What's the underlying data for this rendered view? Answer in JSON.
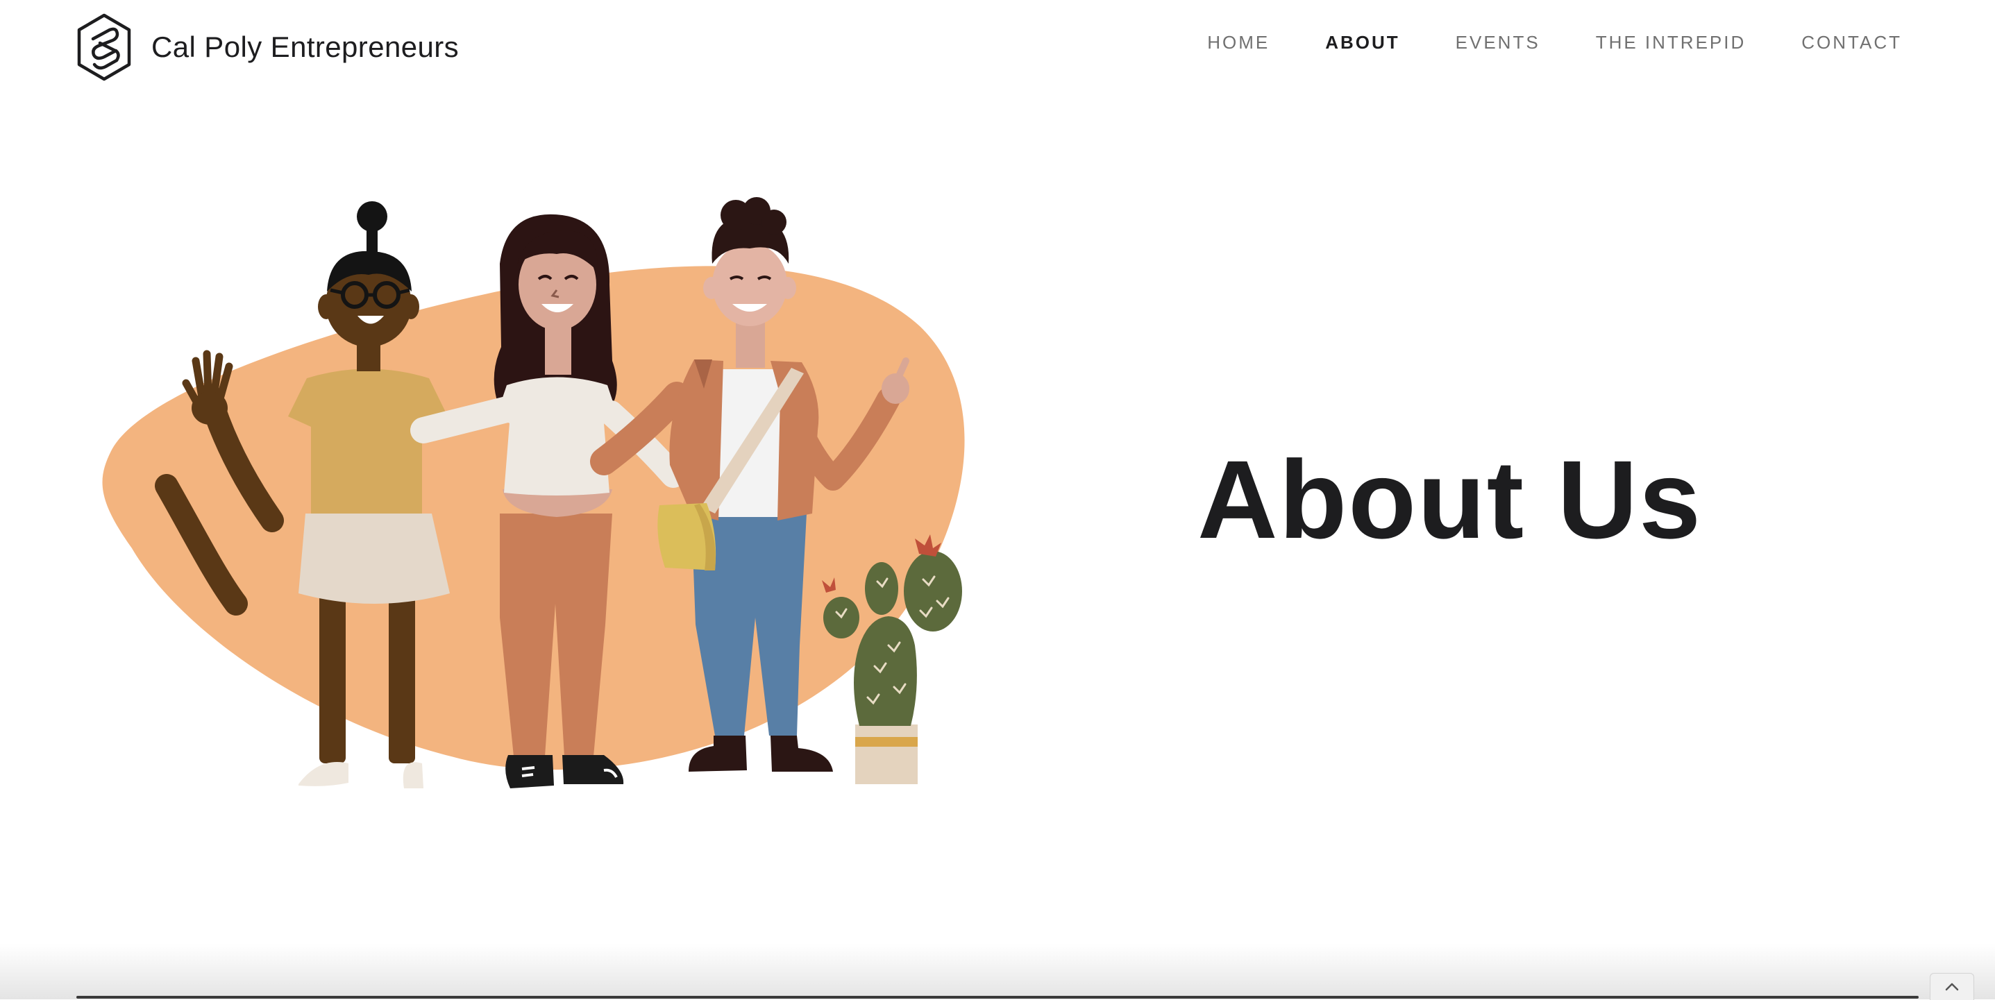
{
  "brand": {
    "name": "Cal Poly Entrepreneurs",
    "logo_icon": "hexagon-link-logo-icon"
  },
  "nav": {
    "items": [
      {
        "label": "HOME",
        "active": false
      },
      {
        "label": "ABOUT",
        "active": true
      },
      {
        "label": "EVENTS",
        "active": false
      },
      {
        "label": "THE INTREPID",
        "active": false
      },
      {
        "label": "CONTACT",
        "active": false
      }
    ]
  },
  "hero": {
    "title": "About Us",
    "illustration": "three-friends-waving-with-cactus-illustration"
  },
  "scroll_top_icon": "chevron-up-icon",
  "colors": {
    "blob": "#F3B47F",
    "text_dark": "#1D1D1F",
    "nav_inactive": "#707070",
    "cactus": "#5C6A3C",
    "jeans": "#587FA6"
  }
}
